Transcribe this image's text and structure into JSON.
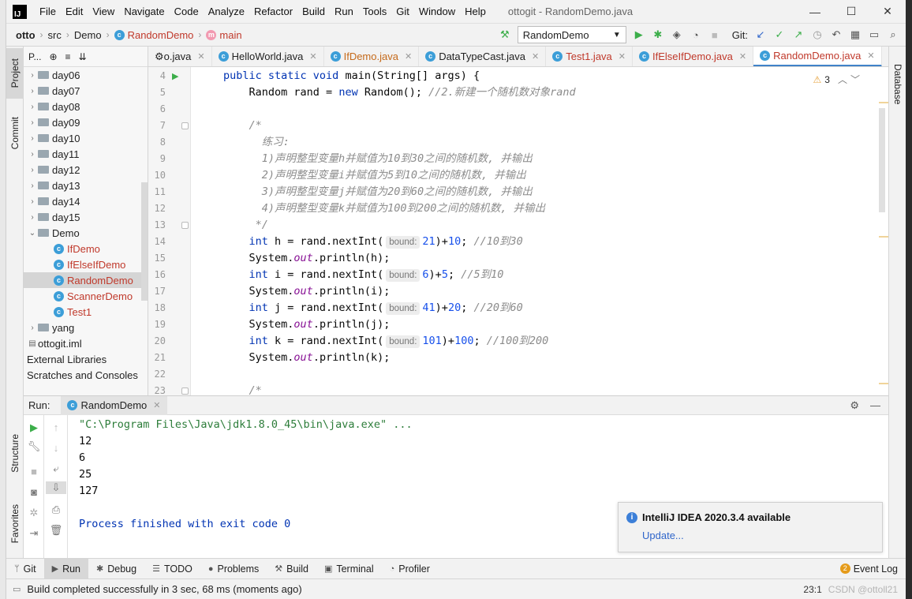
{
  "window": {
    "title": "ottogit - RandomDemo.java",
    "menu": [
      "File",
      "Edit",
      "View",
      "Navigate",
      "Code",
      "Analyze",
      "Refactor",
      "Build",
      "Run",
      "Tools",
      "Git",
      "Window",
      "Help"
    ],
    "controls": {
      "minimize": "—",
      "maximize": "☐",
      "close": "✕"
    }
  },
  "navbar": {
    "breadcrumbs": [
      "otto",
      "src",
      "Demo",
      "RandomDemo",
      "main"
    ],
    "run_config": "RandomDemo",
    "git_label": "Git:"
  },
  "left_strip": {
    "project": "Project",
    "commit": "Commit",
    "structure": "Structure",
    "favorites": "Favorites"
  },
  "right_strip": {
    "database": "Database"
  },
  "project": {
    "header_label": "P...",
    "tree": [
      {
        "label": "day06",
        "type": "folder",
        "depth": 0
      },
      {
        "label": "day07",
        "type": "folder",
        "depth": 0
      },
      {
        "label": "day08",
        "type": "folder",
        "depth": 0
      },
      {
        "label": "day09",
        "type": "folder",
        "depth": 0
      },
      {
        "label": "day10",
        "type": "folder",
        "depth": 0
      },
      {
        "label": "day11",
        "type": "folder",
        "depth": 0
      },
      {
        "label": "day12",
        "type": "folder",
        "depth": 0
      },
      {
        "label": "day13",
        "type": "folder",
        "depth": 0
      },
      {
        "label": "day14",
        "type": "folder",
        "depth": 0
      },
      {
        "label": "day15",
        "type": "folder",
        "depth": 0
      },
      {
        "label": "Demo",
        "type": "folder-open",
        "depth": 0
      },
      {
        "label": "IfDemo",
        "type": "class",
        "depth": 1
      },
      {
        "label": "IfElseIfDemo",
        "type": "class",
        "depth": 1
      },
      {
        "label": "RandomDemo",
        "type": "class",
        "depth": 1,
        "selected": true
      },
      {
        "label": "ScannerDemo",
        "type": "class",
        "depth": 1
      },
      {
        "label": "Test1",
        "type": "class",
        "depth": 1
      },
      {
        "label": "yang",
        "type": "folder",
        "depth": 0
      },
      {
        "label": "ottogit.iml",
        "type": "file",
        "depth": 0
      },
      {
        "label": "External Libraries",
        "type": "plain",
        "depth": 0
      },
      {
        "label": "Scratches and Consoles",
        "type": "plain",
        "depth": 0
      }
    ]
  },
  "tabs": [
    {
      "label": "o.java",
      "icon": "settings"
    },
    {
      "label": "HelloWorld.java",
      "icon": "class"
    },
    {
      "label": "IfDemo.java",
      "icon": "class",
      "style": "orange"
    },
    {
      "label": "DataTypeCast.java",
      "icon": "class"
    },
    {
      "label": "Test1.java",
      "icon": "class",
      "style": "red"
    },
    {
      "label": "IfElseIfDemo.java",
      "icon": "class",
      "style": "red"
    },
    {
      "label": "RandomDemo.java",
      "icon": "class",
      "style": "red",
      "active": true
    },
    {
      "label": "",
      "icon": "class"
    }
  ],
  "editor": {
    "warning_count": "3",
    "line_numbers": [
      "4",
      "5",
      "6",
      "7",
      "8",
      "9",
      "10",
      "11",
      "12",
      "13",
      "14",
      "15",
      "16",
      "17",
      "18",
      "19",
      "20",
      "21",
      "22",
      "23"
    ],
    "code": {
      "l4": {
        "kw": "public static void",
        "rest": " main(String[] args) {"
      },
      "l5": {
        "pre": "    Random rand = ",
        "kw": "new",
        "post": " Random(); ",
        "cmt": "//2.新建一个随机数对象rand"
      },
      "l7": "    /*",
      "l8": "      练习:",
      "l9": "      1)声明整型变量h并赋值为10到30之间的随机数, 并输出",
      "l10": "      2)声明整型变量i并赋值为5到10之间的随机数, 并输出",
      "l11": "      3)声明整型变量j并赋值为20到60之间的随机数, 并输出",
      "l12": "      4)声明整型变量k并赋值为100到200之间的随机数, 并输出",
      "l13": "     */",
      "hint_label": "bound:",
      "assignments": [
        {
          "var": "h",
          "bound": "21",
          "offset": "10",
          "comment": "//10到30"
        },
        {
          "var": "i",
          "bound": "6",
          "offset": "5",
          "comment": "//5到10"
        },
        {
          "var": "j",
          "bound": "41",
          "offset": "20",
          "comment": "//20到60"
        },
        {
          "var": "k",
          "bound": "101",
          "offset": "100",
          "comment": "//100到200"
        }
      ],
      "type_kw": "int",
      "call": "rand.nextInt(",
      "print_pre": "System.",
      "print_field": "out",
      "print_post": ".println(",
      "l23": "    /*"
    }
  },
  "run": {
    "label": "Run:",
    "tab": "RandomDemo",
    "console": [
      {
        "text": "\"C:\\Program Files\\Java\\jdk1.8.0_45\\bin\\java.exe\" ...",
        "style": "cmd"
      },
      {
        "text": "12",
        "style": "out"
      },
      {
        "text": "6",
        "style": "out"
      },
      {
        "text": "25",
        "style": "out"
      },
      {
        "text": "127",
        "style": "out"
      },
      {
        "text": "",
        "style": "out"
      },
      {
        "text": "Process finished with exit code 0",
        "style": "exit"
      }
    ]
  },
  "notification": {
    "title": "IntelliJ IDEA 2020.3.4 available",
    "link": "Update..."
  },
  "bottom_bar": {
    "items": [
      "Git",
      "Run",
      "Debug",
      "TODO",
      "Problems",
      "Build",
      "Terminal",
      "Profiler"
    ],
    "event_log": "Event Log",
    "event_count": "2"
  },
  "status": {
    "message": "Build completed successfully in 3 sec, 68 ms (moments ago)",
    "position": "23:1",
    "watermark": "CSDN @ottoll21"
  },
  "colors": {
    "accent": "#4083c9",
    "keyword": "#0033b3",
    "number": "#1750eb",
    "comment": "#8c8c8c",
    "run_green": "#3cae4a"
  }
}
